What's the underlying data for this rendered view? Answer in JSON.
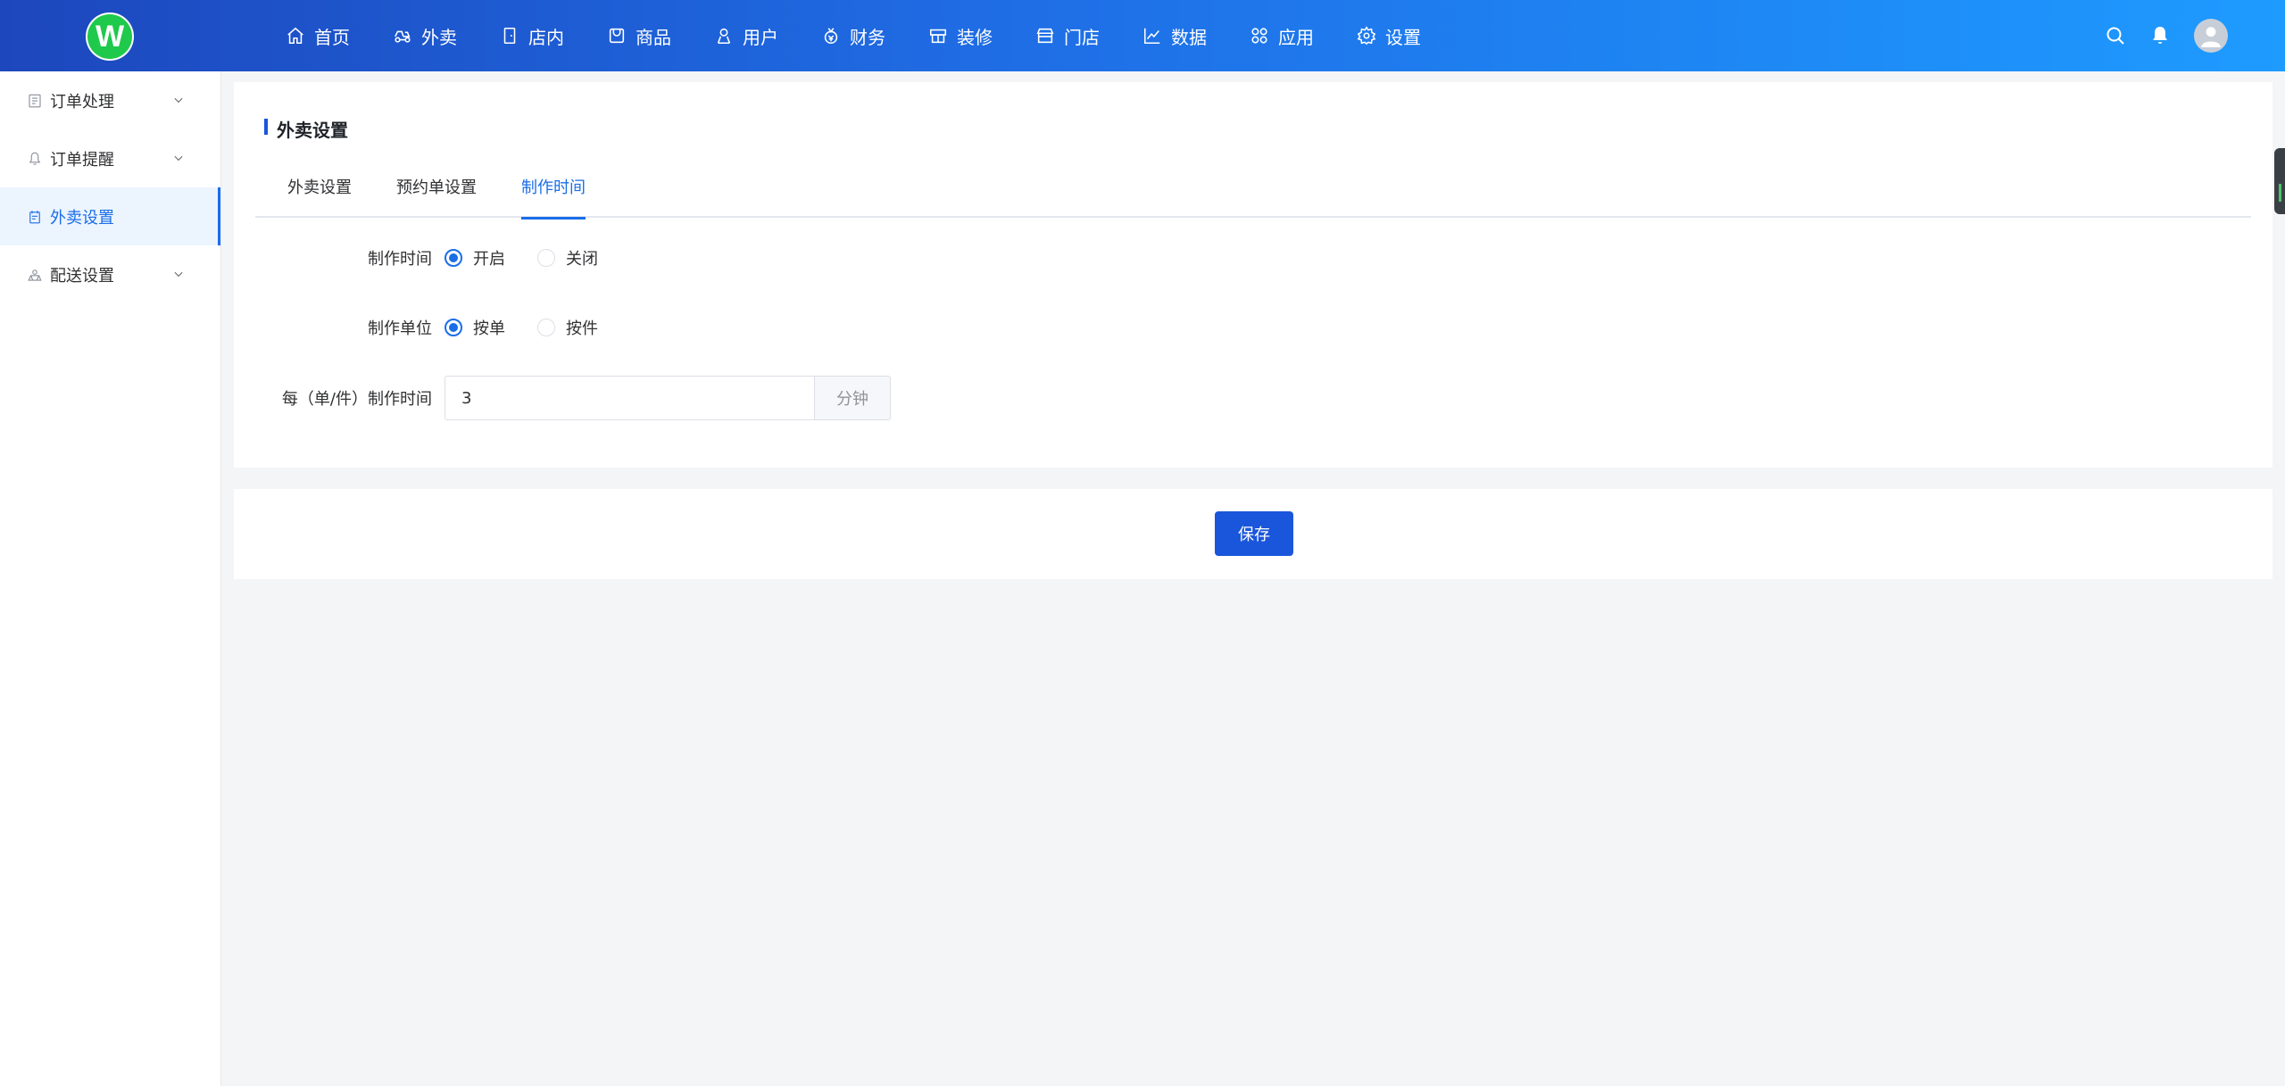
{
  "header": {
    "logo_letter": "W",
    "nav": [
      {
        "label": "首页",
        "icon": "home-icon"
      },
      {
        "label": "外卖",
        "icon": "delivery-icon"
      },
      {
        "label": "店内",
        "icon": "store-in-icon"
      },
      {
        "label": "商品",
        "icon": "goods-icon"
      },
      {
        "label": "用户",
        "icon": "user-icon"
      },
      {
        "label": "财务",
        "icon": "finance-icon"
      },
      {
        "label": "装修",
        "icon": "decoration-icon"
      },
      {
        "label": "门店",
        "icon": "shop-icon"
      },
      {
        "label": "数据",
        "icon": "chart-icon"
      },
      {
        "label": "应用",
        "icon": "apps-icon"
      },
      {
        "label": "设置",
        "icon": "settings-icon"
      }
    ]
  },
  "sidebar": {
    "items": [
      {
        "label": "订单处理",
        "icon": "order-icon",
        "expandable": true
      },
      {
        "label": "订单提醒",
        "icon": "bell-icon",
        "expandable": true
      },
      {
        "label": "外卖设置",
        "icon": "takeout-settings-icon",
        "expandable": false,
        "active": true
      },
      {
        "label": "配送设置",
        "icon": "delivery-settings-icon",
        "expandable": true
      }
    ]
  },
  "main": {
    "title": "外卖设置",
    "tabs": [
      {
        "label": "外卖设置"
      },
      {
        "label": "预约单设置"
      },
      {
        "label": "制作时间",
        "active": true
      }
    ],
    "form": {
      "making_time": {
        "label": "制作时间",
        "options": [
          "开启",
          "关闭"
        ],
        "selected": "开启"
      },
      "making_unit": {
        "label": "制作单位",
        "options": [
          "按单",
          "按件"
        ],
        "selected": "按单"
      },
      "per_time": {
        "label": "每（单/件）制作时间",
        "value": "3",
        "unit": "分钟"
      }
    },
    "save_label": "保存"
  },
  "colors": {
    "primary": "#1a6ee8",
    "button": "#1a56db",
    "header_gradient_start": "#1d47bd",
    "header_gradient_end": "#1e9bff",
    "logo_green": "#1fc94b"
  }
}
